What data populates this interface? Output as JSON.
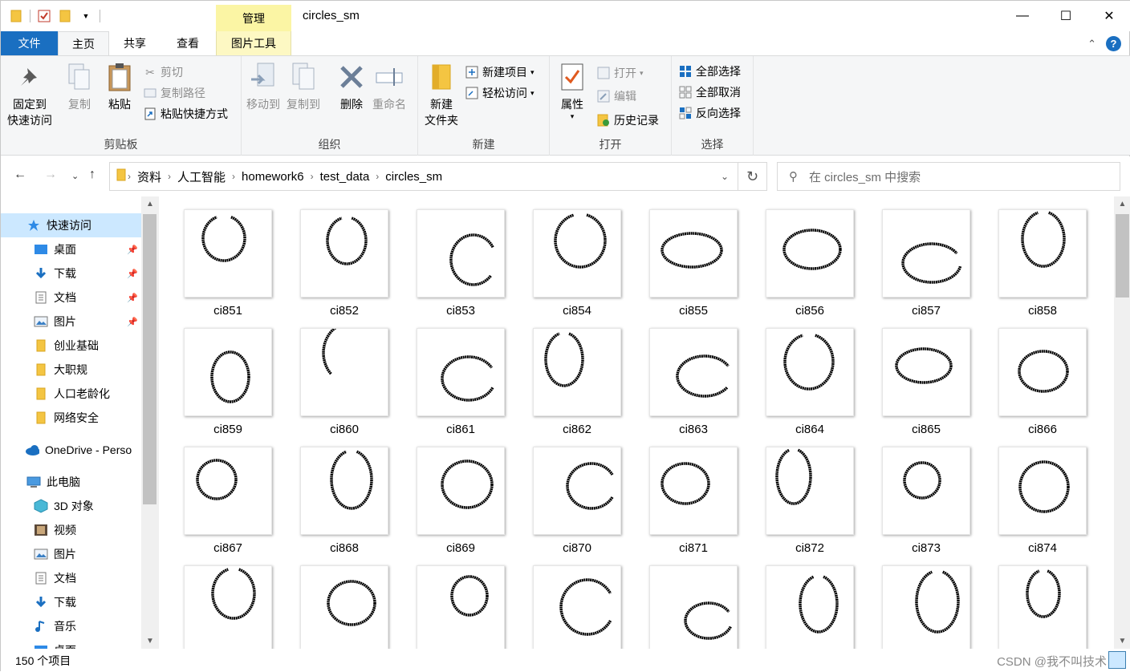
{
  "window": {
    "title": "circles_sm",
    "manage_tab": "管理",
    "controls": {
      "minimize": "—",
      "maximize": "☐",
      "close": "✕"
    }
  },
  "tabs": {
    "file": "文件",
    "home": "主页",
    "share": "共享",
    "view": "查看",
    "picture_tools": "图片工具"
  },
  "ribbon": {
    "clipboard": {
      "label": "剪贴板",
      "pin": "固定到\n快速访问",
      "copy": "复制",
      "paste": "粘贴",
      "cut": "剪切",
      "copy_path": "复制路径",
      "paste_shortcut": "粘贴快捷方式"
    },
    "organize": {
      "label": "组织",
      "move_to": "移动到",
      "copy_to": "复制到",
      "delete": "删除",
      "rename": "重命名"
    },
    "new": {
      "label": "新建",
      "new_folder": "新建\n文件夹",
      "new_item": "新建项目",
      "easy_access": "轻松访问"
    },
    "open": {
      "label": "打开",
      "properties": "属性",
      "open": "打开",
      "edit": "编辑",
      "history": "历史记录"
    },
    "select": {
      "label": "选择",
      "select_all": "全部选择",
      "select_none": "全部取消",
      "invert": "反向选择"
    }
  },
  "address": {
    "crumbs": [
      "资料",
      "人工智能",
      "homework6",
      "test_data",
      "circles_sm"
    ],
    "search_placeholder": "在 circles_sm 中搜索"
  },
  "nav": {
    "quick_access": "快速访问",
    "items": [
      {
        "label": "桌面",
        "icon": "desktop-icon",
        "pinned": true
      },
      {
        "label": "下载",
        "icon": "download-icon",
        "pinned": true
      },
      {
        "label": "文档",
        "icon": "document-icon",
        "pinned": true
      },
      {
        "label": "图片",
        "icon": "picture-icon",
        "pinned": true
      },
      {
        "label": "创业基础",
        "icon": "folder-icon",
        "pinned": false
      },
      {
        "label": "大职规",
        "icon": "folder-icon",
        "pinned": false
      },
      {
        "label": "人口老龄化",
        "icon": "folder-icon",
        "pinned": false
      },
      {
        "label": "网络安全",
        "icon": "folder-icon",
        "pinned": false
      }
    ],
    "onedrive": "OneDrive - Perso",
    "this_pc": "此电脑",
    "pc_items": [
      {
        "label": "3D 对象",
        "icon": "3d-objects-icon"
      },
      {
        "label": "视频",
        "icon": "video-icon"
      },
      {
        "label": "图片",
        "icon": "picture-icon"
      },
      {
        "label": "文档",
        "icon": "document-icon"
      },
      {
        "label": "下载",
        "icon": "download-icon"
      },
      {
        "label": "音乐",
        "icon": "music-icon"
      },
      {
        "label": "桌面",
        "icon": "desktop-icon"
      }
    ]
  },
  "files": [
    {
      "name": "ci851"
    },
    {
      "name": "ci852"
    },
    {
      "name": "ci853"
    },
    {
      "name": "ci854"
    },
    {
      "name": "ci855"
    },
    {
      "name": "ci856"
    },
    {
      "name": "ci857"
    },
    {
      "name": "ci858"
    },
    {
      "name": "ci859"
    },
    {
      "name": "ci860"
    },
    {
      "name": "ci861"
    },
    {
      "name": "ci862"
    },
    {
      "name": "ci863"
    },
    {
      "name": "ci864"
    },
    {
      "name": "ci865"
    },
    {
      "name": "ci866"
    },
    {
      "name": "ci867"
    },
    {
      "name": "ci868"
    },
    {
      "name": "ci869"
    },
    {
      "name": "ci870"
    },
    {
      "name": "ci871"
    },
    {
      "name": "ci872"
    },
    {
      "name": "ci873"
    },
    {
      "name": "ci874"
    },
    {
      "name": ""
    },
    {
      "name": ""
    },
    {
      "name": ""
    },
    {
      "name": ""
    },
    {
      "name": ""
    },
    {
      "name": ""
    },
    {
      "name": ""
    },
    {
      "name": ""
    }
  ],
  "status": {
    "count": "150 个项目",
    "watermark": "CSDN @我不叫技术"
  }
}
